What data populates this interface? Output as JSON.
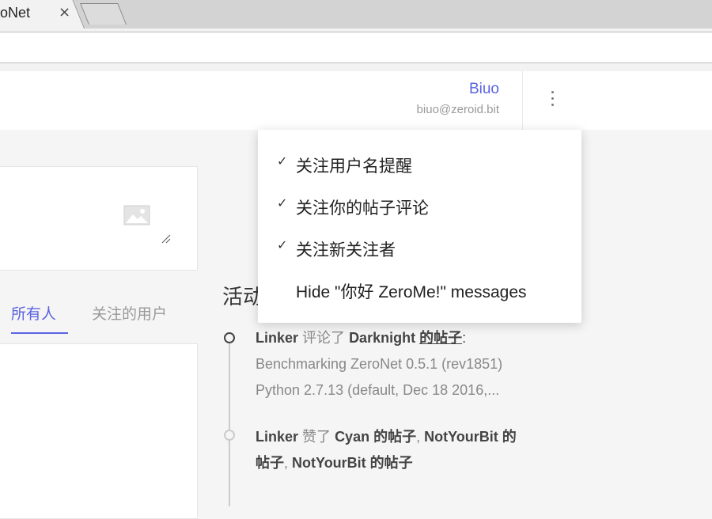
{
  "browser": {
    "tab_title": "oNet",
    "tab_close": "×"
  },
  "header": {
    "user_name": "Biuo",
    "user_email": "biuo@zeroid.bit",
    "more_icon": "vertical-dots-icon"
  },
  "feed": {
    "tabs": [
      {
        "label": "所有人",
        "active": true
      },
      {
        "label": "关注的用户",
        "active": false
      }
    ]
  },
  "activity": {
    "title": "活动",
    "items": [
      {
        "user": "Linker",
        "verb": "评论了",
        "target_user": "Darknight",
        "target_link": "的帖子",
        "suffix": ":",
        "preview_line1": "Benchmarking ZeroNet 0.5.1 (rev1851)",
        "preview_line2": "Python 2.7.13 (default, Dec 18 2016,..."
      },
      {
        "user": "Linker",
        "verb": "赞了",
        "part1": "Cyan 的帖子",
        "part2": "NotYourBit 的",
        "part3": "帖子",
        "part4": "NotYourBit 的帖子",
        "sep": ","
      }
    ]
  },
  "menu": {
    "items": [
      {
        "label": "关注用户名提醒",
        "checked": true
      },
      {
        "label": "关注你的帖子评论",
        "checked": true
      },
      {
        "label": "关注新关注者",
        "checked": true
      },
      {
        "label": "Hide \"你好 ZeroMe!\" messages",
        "checked": false
      }
    ],
    "check_glyph": "✓"
  },
  "colors": {
    "accent": "#5a64e0",
    "muted": "#999999"
  }
}
